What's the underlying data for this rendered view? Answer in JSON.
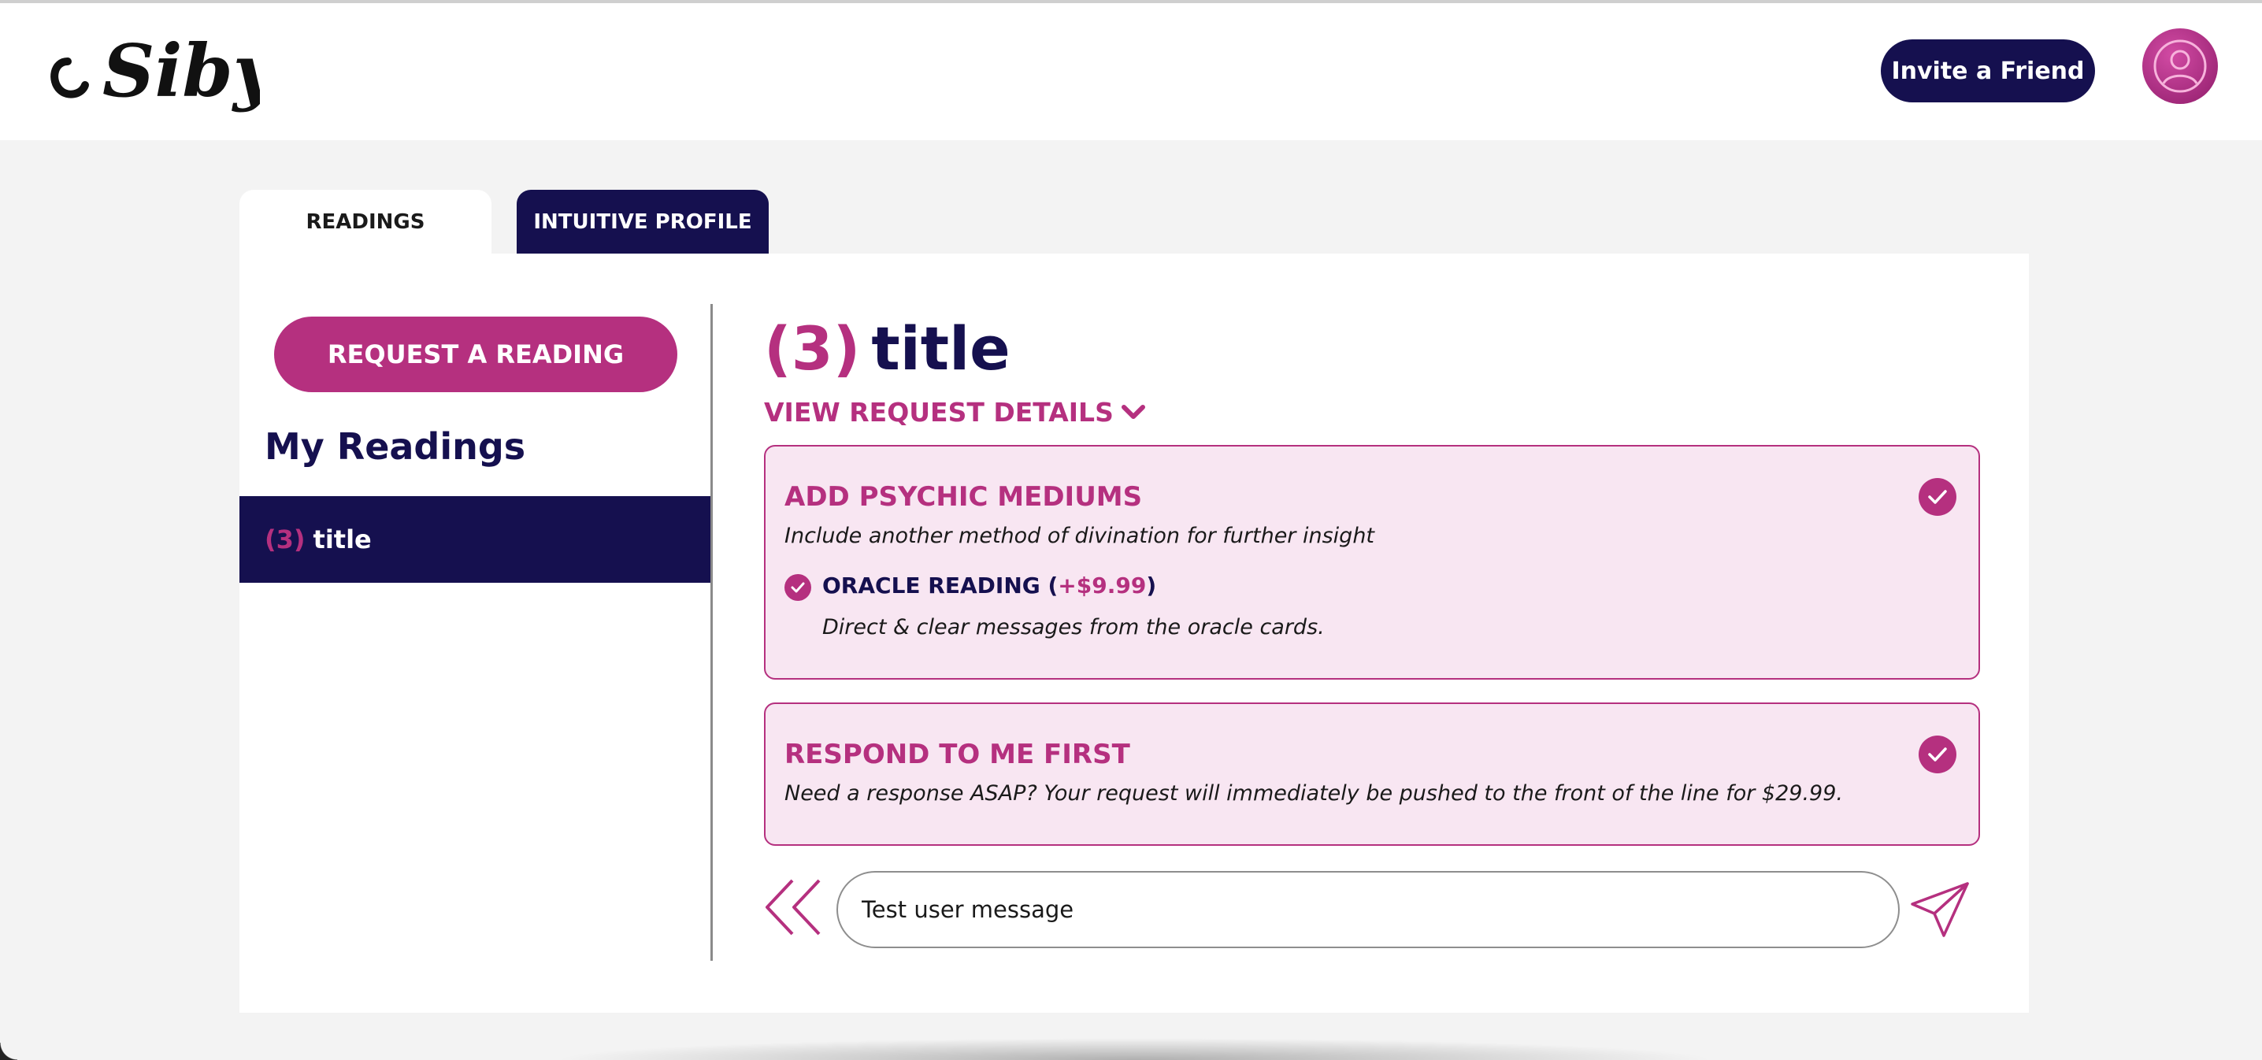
{
  "header": {
    "logo_text": "Sibyl",
    "invite_label": "Invite a Friend"
  },
  "tabs": [
    {
      "label": "READINGS",
      "active": true
    },
    {
      "label": "INTUITIVE PROFILE",
      "active": false
    }
  ],
  "sidebar": {
    "request_button": "REQUEST A READING",
    "heading": "My Readings",
    "items": [
      {
        "count": "(3)",
        "title": "title"
      }
    ]
  },
  "main": {
    "count": "(3)",
    "title": "title",
    "view_details": "VIEW REQUEST DETAILS",
    "cards": [
      {
        "title": "ADD PSYCHIC MEDIUMS",
        "description": "Include another method of divination for further insight",
        "option": {
          "label": "ORACLE READING",
          "paren_open": "(",
          "price": "+$9.99",
          "paren_close": ")",
          "description": "Direct & clear messages from the oracle cards."
        }
      },
      {
        "title": "RESPOND TO ME FIRST",
        "description": "Need a response ASAP? Your request will immediately be pushed to the front of the line for $29.99."
      }
    ],
    "message_value": "Test user message"
  },
  "colors": {
    "navy": "#15104f",
    "magenta": "#b5307f",
    "card_bg": "#f8e6f2",
    "page_bg": "#f3f3f3"
  },
  "icons": [
    "sibyl-logo",
    "avatar-user-icon",
    "chevron-down-icon",
    "check-circle-icon",
    "double-chevron-left-icon",
    "send-paper-plane-icon"
  ]
}
